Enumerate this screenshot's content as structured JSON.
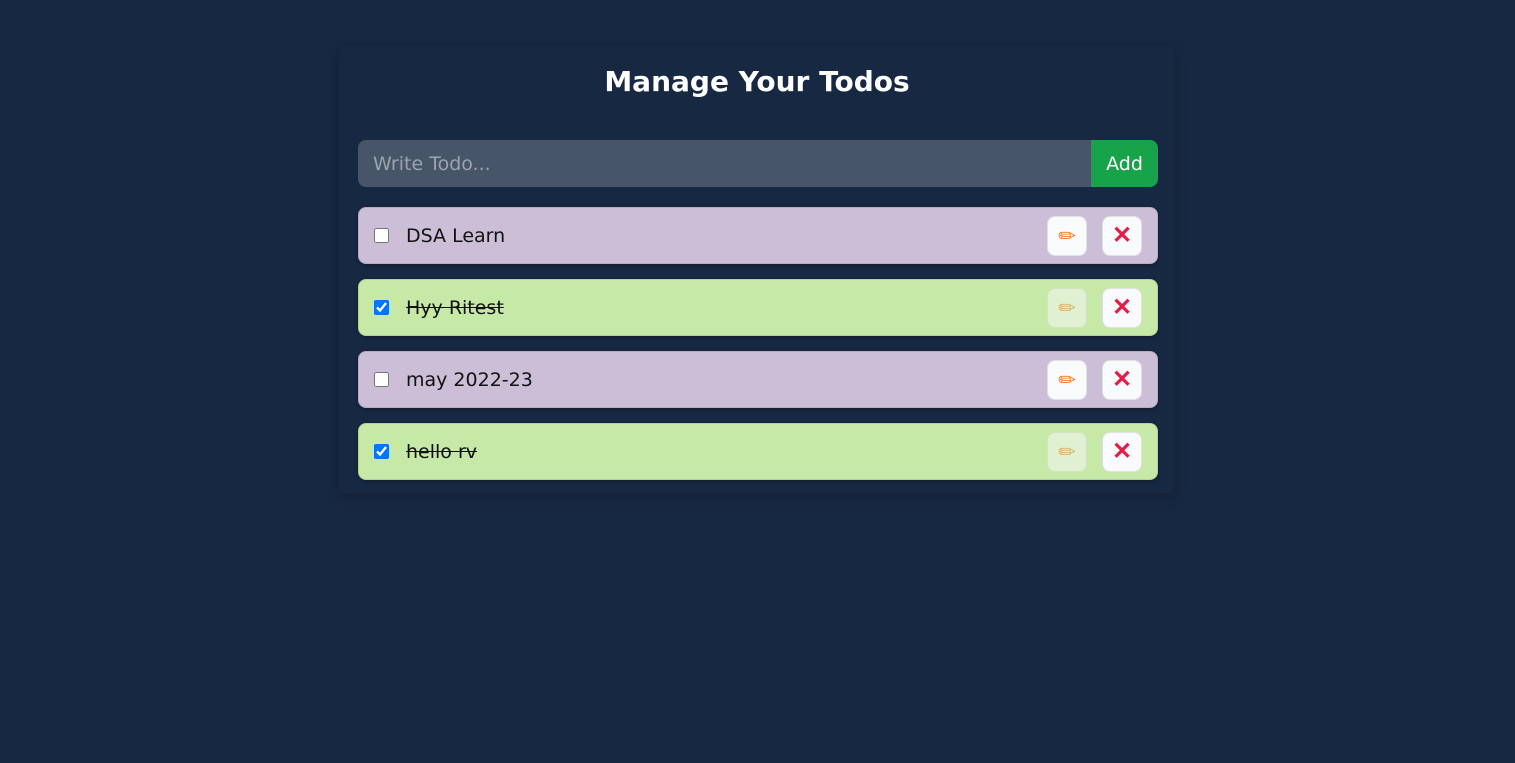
{
  "title": "Manage Your Todos",
  "form": {
    "placeholder": "Write Todo...",
    "value": "",
    "add_label": "Add"
  },
  "icons": {
    "edit": "✏",
    "delete": "✕"
  },
  "colors": {
    "background": "#172842",
    "pending": "#ccbed7",
    "done": "#c6e9a7",
    "add_button": "#16a34a"
  },
  "todos": [
    {
      "text": "DSA Learn",
      "completed": false
    },
    {
      "text": "Hyy Ritest ",
      "completed": true
    },
    {
      "text": "may 2022-23",
      "completed": false
    },
    {
      "text": "hello rv",
      "completed": true
    }
  ]
}
